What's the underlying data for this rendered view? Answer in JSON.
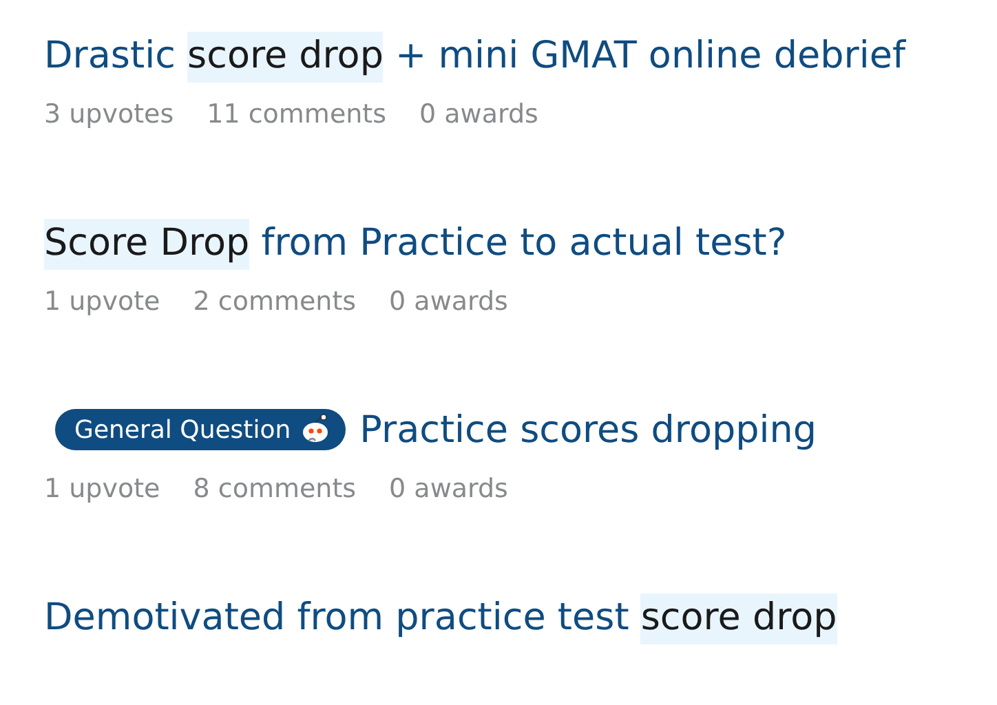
{
  "posts": [
    {
      "title_parts": [
        {
          "text": "Drastic ",
          "highlighted": false
        },
        {
          "text": "score drop",
          "highlighted": true
        },
        {
          "text": " + mini GMAT online debrief",
          "highlighted": false
        }
      ],
      "stats": [
        "3 upvotes",
        "11 comments",
        "0 awards"
      ]
    },
    {
      "title_parts": [
        {
          "text": "Score Drop",
          "highlighted": true
        },
        {
          "text": " from Practice to actual test?",
          "highlighted": false
        }
      ],
      "stats": [
        "1 upvote",
        "2 comments",
        "0 awards"
      ]
    },
    {
      "flair": {
        "label": "General Question"
      },
      "title_parts": [
        {
          "text": "Practice scores dropping",
          "highlighted": false
        }
      ],
      "stats": [
        "1 upvote",
        "8 comments",
        "0 awards"
      ]
    },
    {
      "title_parts": [
        {
          "text": "Demotivated from practice test ",
          "highlighted": false
        },
        {
          "text": "score drop",
          "highlighted": true
        }
      ]
    }
  ]
}
